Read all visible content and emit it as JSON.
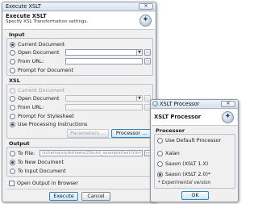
{
  "main": {
    "title": "Execute XSLT",
    "close_glyph": "✕",
    "banner_title": "Execute XSLT",
    "banner_subtitle": "Specify XSL Transformation settings.",
    "banner_icon": "gear-icon",
    "input": {
      "label": "Input",
      "current_document": "Current Document",
      "open_document": "Open Document",
      "from_url": "From URL:",
      "prompt": "Prompt For Document",
      "selected": "current_document"
    },
    "xsl": {
      "label": "XSL",
      "current_document": "Current Document",
      "open_document": "Open Document",
      "from_url": "From URL:",
      "prompt": "Prompt For Stylesheet",
      "use_pi": "Use Processing Instructions",
      "selected": "use_pi",
      "parameters_button": "Parameters ...",
      "processor_button": "Processor ..."
    },
    "output": {
      "label": "Output",
      "to_file": "To File:",
      "to_file_value": "/schema/stylesheets/2/build_example/test.html",
      "to_new_document": "To New Document",
      "to_input_document": "To Input Document",
      "selected": "to_new_document",
      "open_in_browser": "Open Output in Browser",
      "open_in_browser_checked": false
    },
    "execute_button": "Execute",
    "cancel_button": "Cancel",
    "dots_label": "..."
  },
  "processor_dialog": {
    "title": "XSLT Processor",
    "close_glyph": "✕",
    "banner_title": "XSLT Processor",
    "banner_icon": "gear-icon",
    "group_label": "Processor",
    "options": [
      "Use Default Processor",
      "Xalan",
      "Saxon (XSLT 1.X)",
      "Saxon (XSLT 2.0)*"
    ],
    "selected_index": 3,
    "note": "* Experimental version",
    "ok_button": "OK"
  },
  "colors": {
    "window_bg": "#f0f0f0",
    "titlebar": "#dce5f0",
    "selection": "#1f3f66",
    "focus_border": "#3c7fb1"
  }
}
